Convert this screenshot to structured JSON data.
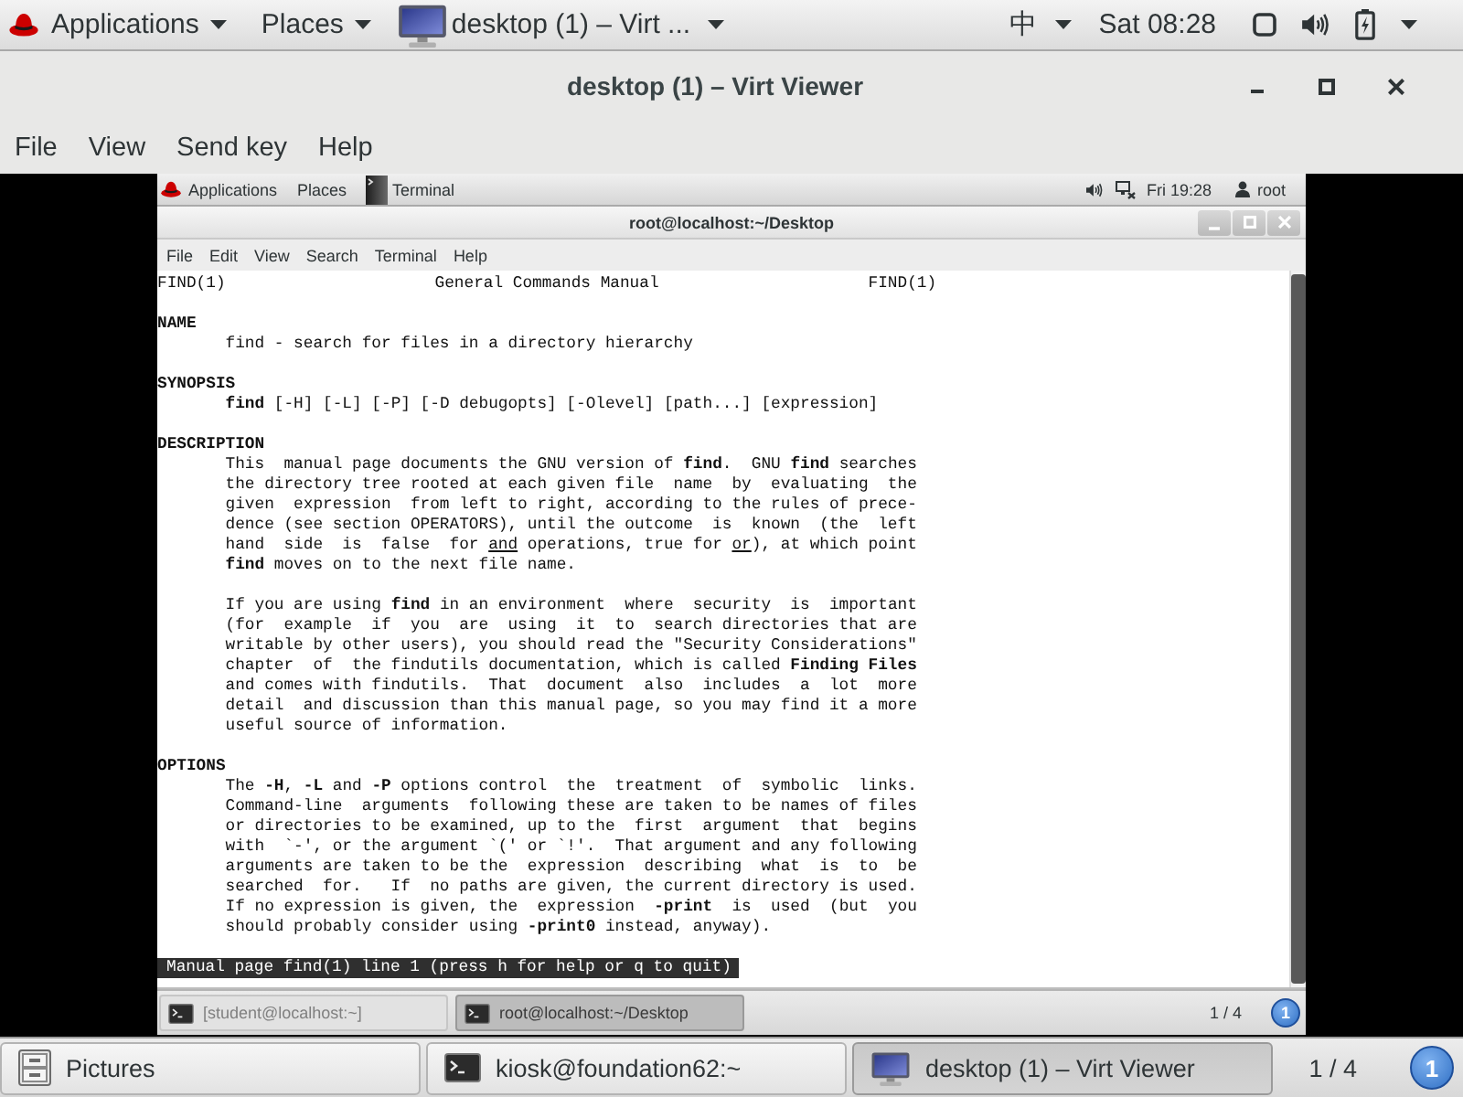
{
  "top_bar": {
    "menus": [
      "Applications",
      "Places"
    ],
    "window_button": "desktop (1) – Virt ...",
    "input_method": "中",
    "clock": "Sat 08:28"
  },
  "window": {
    "title": "desktop (1) – Virt Viewer",
    "menu": [
      "File",
      "View",
      "Send key",
      "Help"
    ]
  },
  "guest": {
    "top_bar": {
      "menus": [
        "Applications",
        "Places"
      ],
      "window_button": "Terminal",
      "clock": "Fri 19:28",
      "user": "root"
    },
    "terminal": {
      "title": "root@localhost:~/Desktop",
      "menu": [
        "File",
        "Edit",
        "View",
        "Search",
        "Terminal",
        "Help"
      ],
      "man_page": {
        "header": [
          "FIND(1)",
          "General Commands Manual",
          "FIND(1)"
        ],
        "sections": [
          {
            "heading": "NAME",
            "paragraphs": [
              [
                "find - search for files in a directory hierarchy"
              ]
            ]
          },
          {
            "heading": "SYNOPSIS",
            "paragraphs": [
              [
                "**find** [-H] [-L] [-P] [-D debugopts] [-Olevel] [path...] [expression]"
              ]
            ]
          },
          {
            "heading": "DESCRIPTION",
            "paragraphs": [
              [
                "This  manual page documents the GNU version of **find**.  GNU **find** searches",
                "the directory tree rooted at each given file  name  by  evaluating  the",
                "given  expression  from left to right, according to the rules of prece-",
                "dence (see section OPERATORS), until the outcome  is  known  (the  left",
                "hand  side  is  false  for *and* operations, true for *or*), at which point",
                "**find** moves on to the next file name."
              ],
              [
                "If you are using **find** in an environment  where  security  is  important",
                "(for  example  if  you  are  using  it  to  search directories that are",
                "writable by other users), you should read the \"Security Considerations\"",
                "chapter  of  the findutils documentation, which is called **Finding Files**",
                "and comes with findutils.  That  document  also  includes  a  lot  more",
                "detail  and discussion than this manual page, so you may find it a more",
                "useful source of information."
              ]
            ]
          },
          {
            "heading": "OPTIONS",
            "paragraphs": [
              [
                "The **-H**, **-L** and **-P** options control  the  treatment  of  symbolic  links.",
                "Command-line  arguments  following these are taken to be names of files",
                "or directories to be examined, up to the  first  argument  that  begins",
                "with  `-', or the argument `(' or `!'.  That argument and any following",
                "arguments are taken to be the  expression  describing  what  is  to  be",
                "searched  for.   If  no paths are given, the current directory is used.",
                "If no expression is given, the  expression  **-print**  is  used  (but  you",
                "should probably consider using **-print0** instead, anyway)."
              ]
            ]
          }
        ]
      },
      "status_line": "Manual page find(1) line 1 (press h for help or q to quit)"
    },
    "taskbar": {
      "windows": [
        {
          "label": "[student@localhost:~]",
          "selected": false
        },
        {
          "label": "root@localhost:~/Desktop",
          "selected": true
        }
      ],
      "pager": "1 / 4",
      "notifications": "1"
    }
  },
  "taskbar": {
    "windows": [
      {
        "kind": "files",
        "label": "Pictures",
        "selected": false
      },
      {
        "kind": "terminal",
        "label": "kiosk@foundation62:~",
        "selected": false
      },
      {
        "kind": "viewer",
        "label": "desktop (1) – Virt Viewer",
        "selected": true
      }
    ],
    "pager": "1 / 4",
    "notifications": "1"
  }
}
